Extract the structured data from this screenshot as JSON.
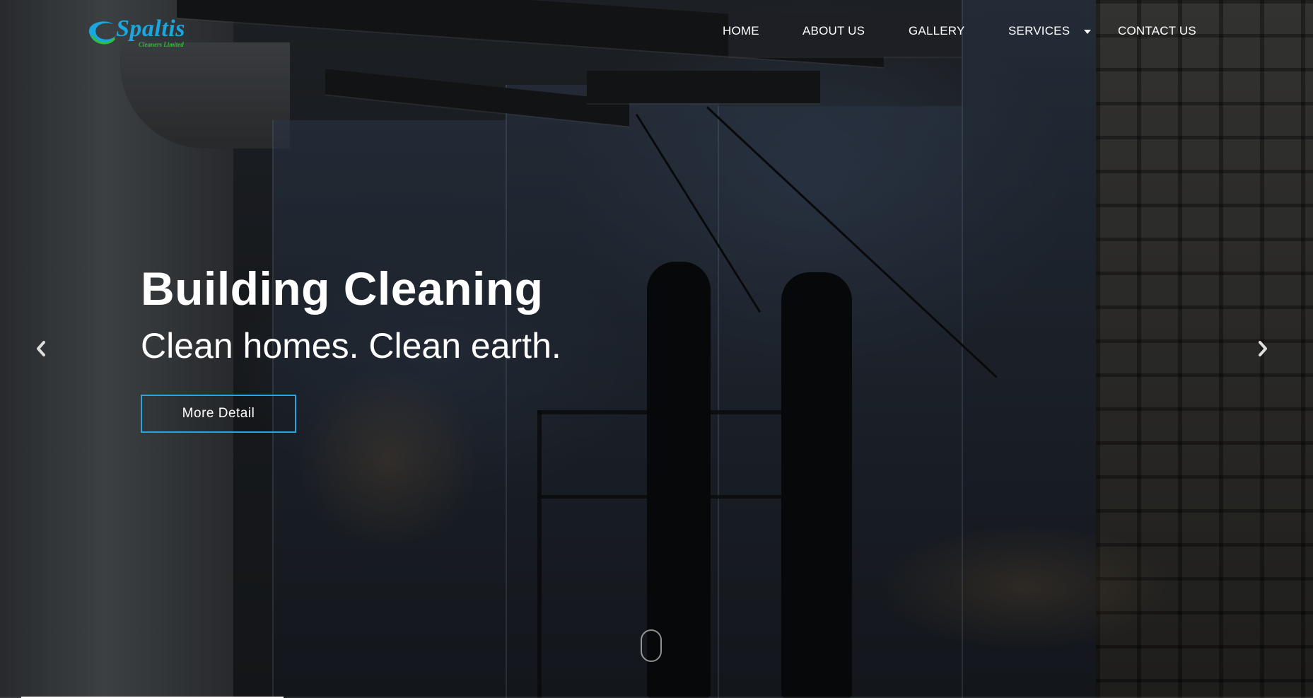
{
  "brand": {
    "name": "Spaltis",
    "tagline": "Cleaners Limited",
    "primary_color": "#1aa7e0",
    "tagline_color": "#2fbf3a"
  },
  "nav": {
    "home": "HOME",
    "about": "ABOUT US",
    "gallery": "GALLERY",
    "services": "SERVICES",
    "contact": "CONTACT US"
  },
  "slide": {
    "title": "Building Cleaning",
    "subtitle": "Clean homes. Clean earth.",
    "button_label": "More Detail",
    "button_border_color": "#2aa4df"
  },
  "carousel": {
    "prev_icon": "chevron-left-icon",
    "next_icon": "chevron-right-icon",
    "scroll_icon": "mouse-scroll-icon",
    "progress_fraction": 0.2
  }
}
